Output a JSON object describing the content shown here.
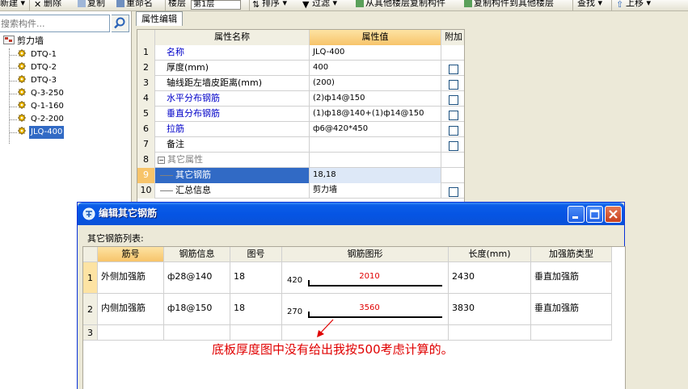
{
  "toolbar": {
    "items": [
      "新建",
      "删除",
      "复制",
      "重命名",
      "楼层",
      "第1层",
      "排序",
      "过滤",
      "从其他楼层复制构件",
      "复制构件到其他楼层",
      "查找",
      "上移"
    ]
  },
  "left_panel": {
    "search_placeholder": "搜索构件...",
    "tree_root": "剪力墙",
    "tree_items": [
      "DTQ-1",
      "DTQ-2",
      "DTQ-3",
      "Q-3-250",
      "Q-1-160",
      "Q-2-200",
      "JLQ-400"
    ],
    "selected_item": "JLQ-400"
  },
  "property_panel": {
    "tab_label": "属性编辑",
    "headers": {
      "name": "属性名称",
      "value": "属性值",
      "extra": "附加"
    },
    "rows": [
      {
        "num": "1",
        "name": "名称",
        "value": "JLQ-400",
        "blue": true,
        "checkbox": false
      },
      {
        "num": "2",
        "name": "厚度(mm)",
        "value": "400",
        "blue": false,
        "checkbox": true
      },
      {
        "num": "3",
        "name": "轴线距左墙皮距离(mm)",
        "value": "(200)",
        "blue": false,
        "checkbox": true
      },
      {
        "num": "4",
        "name": "水平分布钢筋",
        "value": "(2)ф14@150",
        "blue": true,
        "checkbox": true
      },
      {
        "num": "5",
        "name": "垂直分布钢筋",
        "value": "(1)ф18@140+(1)ф14@150",
        "blue": true,
        "checkbox": true
      },
      {
        "num": "6",
        "name": "拉筋",
        "value": "ф6@420*450",
        "blue": true,
        "checkbox": true
      },
      {
        "num": "7",
        "name": "备注",
        "value": "",
        "blue": false,
        "checkbox": true
      },
      {
        "num": "8",
        "name": "其它属性",
        "value": "",
        "blue": false,
        "checkbox": false
      },
      {
        "num": "9",
        "name": "其它钢筋",
        "value": "18,18",
        "blue": false,
        "checkbox": false
      },
      {
        "num": "10",
        "name": "汇总信息",
        "value": "剪力墙",
        "blue": false,
        "checkbox": true
      }
    ],
    "collapse_symbol": "−"
  },
  "dialog": {
    "title": "编辑其它钢筋",
    "list_label": "其它钢筋列表:",
    "columns": [
      "筋号",
      "钢筋信息",
      "图号",
      "钢筋图形",
      "长度(mm)",
      "加强筋类型"
    ],
    "rows": [
      {
        "num": "1",
        "name": "外侧加强筋",
        "info": "ф28@140",
        "fig": "18",
        "shape_left": "420",
        "shape_top": "2010",
        "length": "2430",
        "type": "垂直加强筋"
      },
      {
        "num": "2",
        "name": "内侧加强筋",
        "info": "ф18@150",
        "fig": "18",
        "shape_left": "270",
        "shape_top": "3560",
        "length": "3830",
        "type": "垂直加强筋"
      },
      {
        "num": "3",
        "name": "",
        "info": "",
        "fig": "",
        "shape_left": "",
        "shape_top": "",
        "length": "",
        "type": ""
      }
    ]
  },
  "annotation": "底板厚度图中没有给出我按500考虑计算的。",
  "colors": {
    "annotation": "#e00000",
    "selection": "#316ac5",
    "header_highlight": "#f7c46a",
    "link_text": "#0000c8"
  }
}
